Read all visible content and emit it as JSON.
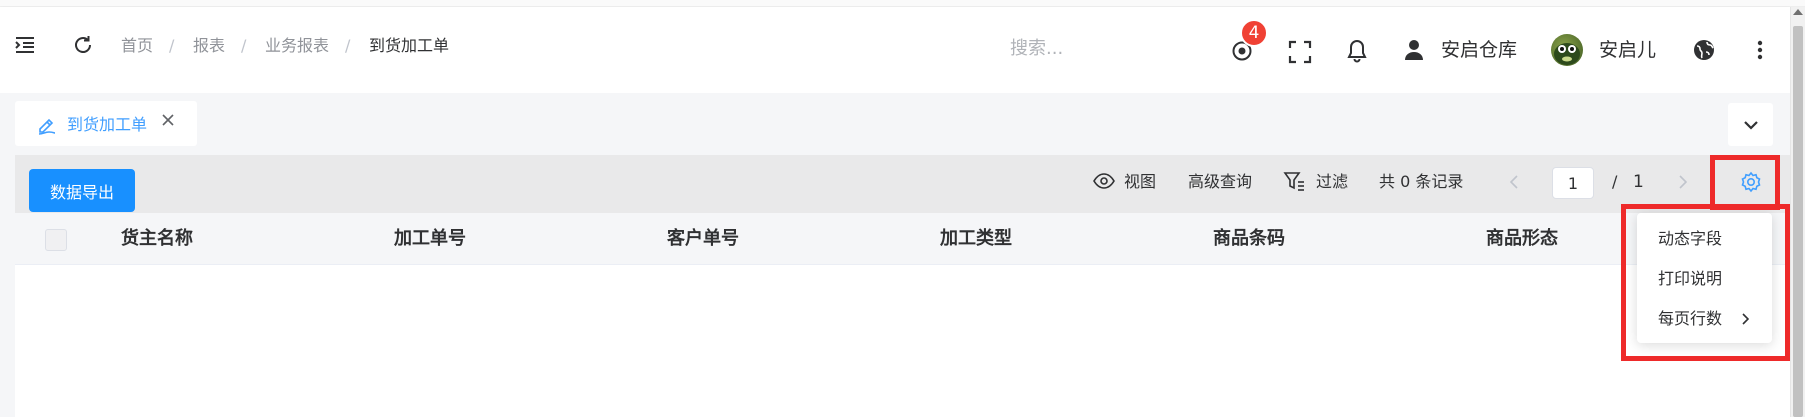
{
  "header": {
    "breadcrumb": [
      "首页",
      "报表",
      "业务报表",
      "到货加工单"
    ],
    "breadcrumb_separator": "/",
    "search_placeholder": "搜索...",
    "notification_badge": "4",
    "warehouse": "安启仓库",
    "username": "安启儿"
  },
  "tabs": [
    {
      "label": "到货加工单"
    }
  ],
  "toolbar": {
    "export_label": "数据导出",
    "view_label": "视图",
    "advanced_query_label": "高级查询",
    "filter_label": "过滤",
    "record_count": "共 0 条记录",
    "page_current": "1",
    "page_separator": "/",
    "page_total": "1"
  },
  "table": {
    "columns": [
      "货主名称",
      "加工单号",
      "客户单号",
      "加工类型",
      "商品条码",
      "商品形态"
    ],
    "rows": []
  },
  "settings_menu": {
    "items": [
      "动态字段",
      "打印说明",
      "每页行数"
    ]
  },
  "colors": {
    "accent": "#1890ff",
    "link": "#409eff",
    "badge": "#f04134",
    "highlight": "#ee2a2a"
  }
}
